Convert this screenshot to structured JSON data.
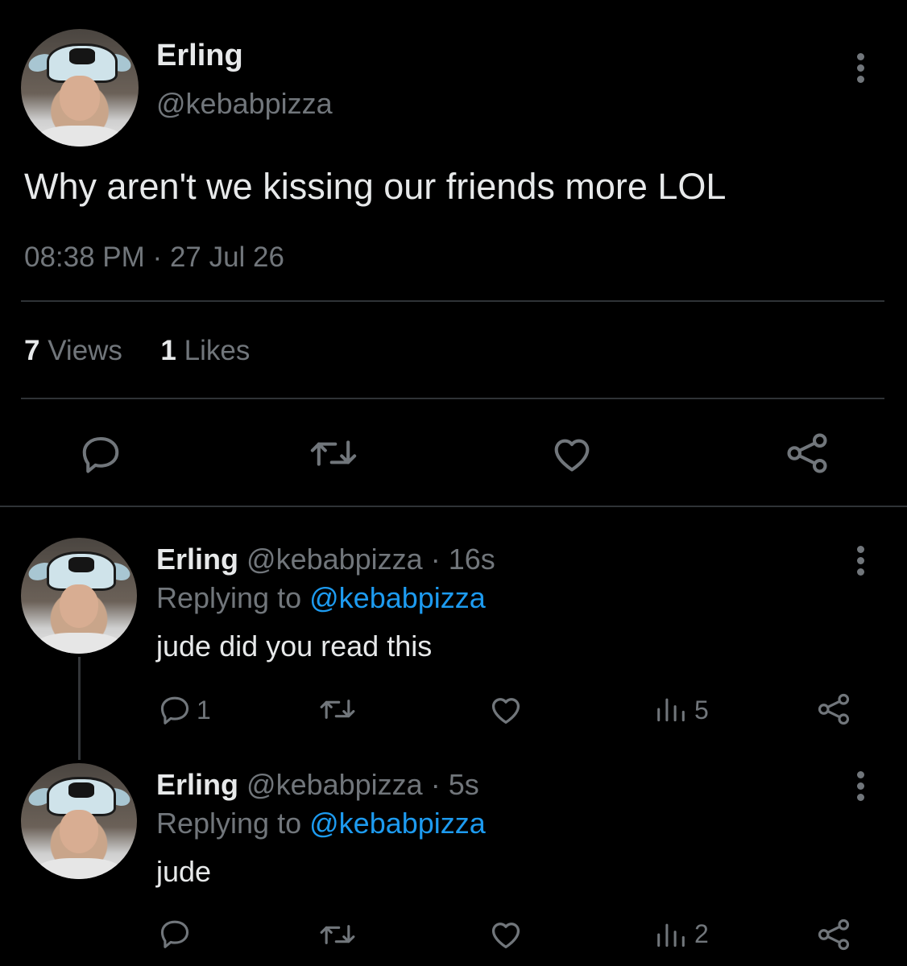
{
  "main_tweet": {
    "display_name": "Erling",
    "handle": "@kebabpizza",
    "text": "Why aren't we kissing our friends more LOL",
    "time": "08:38 PM",
    "separator": "·",
    "date": "27 Jul 26",
    "views_count": "7",
    "views_label": "Views",
    "likes_count": "1",
    "likes_label": "Likes"
  },
  "replies": [
    {
      "display_name": "Erling",
      "handle": "@kebabpizza",
      "age": "· 16s",
      "replying_prefix": "Replying to",
      "replying_handle": "@kebabpizza",
      "text": "jude did you read this",
      "reply_count": "1",
      "views_count": "5"
    },
    {
      "display_name": "Erling",
      "handle": "@kebabpizza",
      "age": "· 5s",
      "replying_prefix": "Replying to",
      "replying_handle": "@kebabpizza",
      "text": "jude",
      "reply_count": "",
      "views_count": "2"
    }
  ],
  "icons": {
    "reply": "reply-icon",
    "retweet": "retweet-icon",
    "like": "heart-icon",
    "views": "views-chart-icon",
    "share": "share-icon",
    "more": "more-dots-icon"
  },
  "colors": {
    "background": "#000000",
    "text": "#e7e9ea",
    "muted": "#71767b",
    "link": "#1d9bf0",
    "divider": "#2f3336"
  }
}
